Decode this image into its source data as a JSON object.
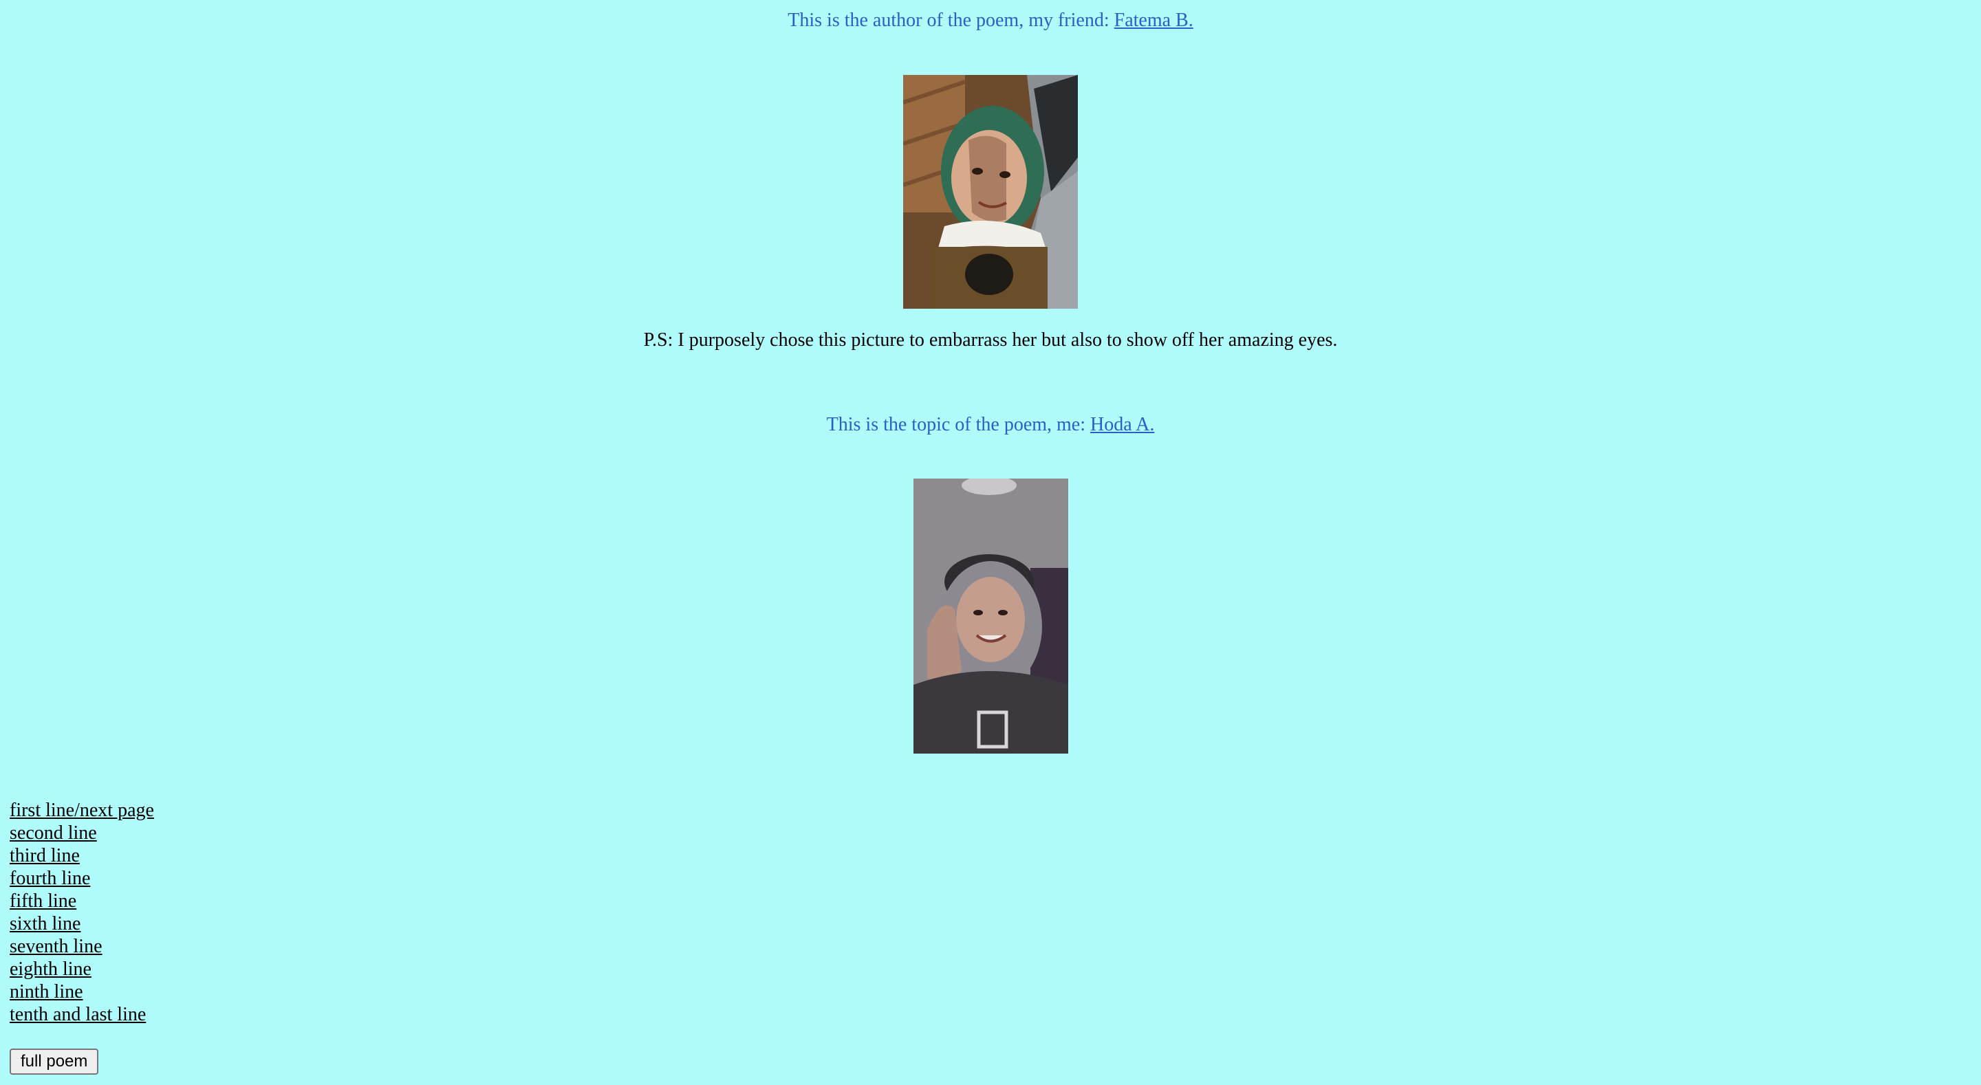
{
  "author": {
    "intro": "This is the author of the poem, my friend: ",
    "name_link": "Fatema B."
  },
  "ps_text": "P.S: I purposely chose this picture to embarrass her but also to show off her amazing eyes.",
  "topic": {
    "intro": "This is the topic of the poem, me: ",
    "name_link": "Hoda A."
  },
  "line_links": [
    "first line/next page",
    "second line",
    "third line",
    "fourth line",
    "fifth line",
    "sixth line",
    "seventh line",
    "eighth line",
    "ninth line",
    "tenth and last line"
  ],
  "full_poem_button": "full poem",
  "colors": {
    "background": "#b0fcfc",
    "heading_text": "#2a5fc9"
  }
}
